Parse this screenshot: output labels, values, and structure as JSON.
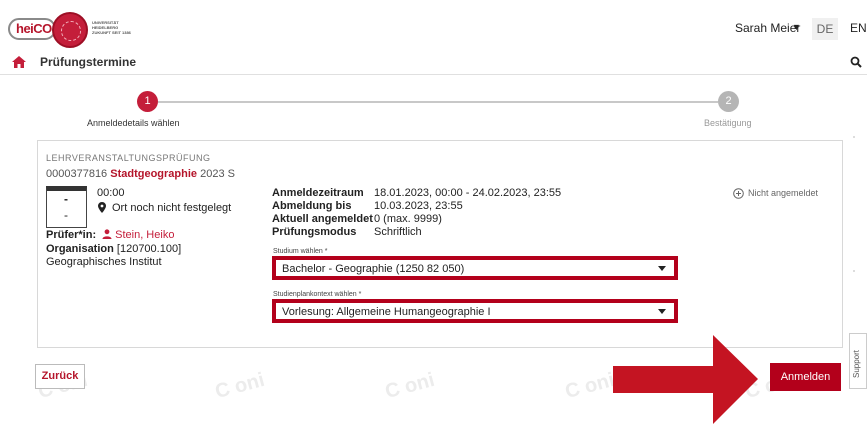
{
  "header": {
    "logo": "heiCO",
    "university_logo_text": "UNIVERSITÄT HEIDELBERG ZUKUNFT SEIT 1386",
    "user_name": "Sarah Meier",
    "lang_de": "DE",
    "lang_en": "EN"
  },
  "nav": {
    "page_title": "Prüfungstermine"
  },
  "stepper": {
    "steps": [
      {
        "num": "1",
        "label": "Anmeldedetails wählen"
      },
      {
        "num": "2",
        "label": "Bestätigung"
      }
    ]
  },
  "exam": {
    "kicker": "LEHRVERANSTALTUNGSPRÜFUNG",
    "course_number": "0000377816",
    "course_title": "Stadtgeographie",
    "semester": "2023 S",
    "date_day": "-",
    "date_month": "-",
    "time": "00:00",
    "location": "Ort noch nicht festgelegt",
    "examiner_label": "Prüfer*in:",
    "examiner": "Stein, Heiko",
    "org_label": "Organisation",
    "org_value": "[120700.100] Geographisches Institut",
    "details": [
      {
        "label": "Anmeldezeitraum",
        "value": "18.01.2023, 00:00 - 24.02.2023, 23:55"
      },
      {
        "label": "Abmeldung bis",
        "value": "10.03.2023, 23:55"
      },
      {
        "label": "Aktuell angemeldet",
        "value": "0 (max. 9999)"
      },
      {
        "label": "Prüfungsmodus",
        "value": "Schriftlich"
      }
    ],
    "status": "Nicht angemeldet"
  },
  "form": {
    "studium_label": "Studium wählen *",
    "studium_value": "Bachelor - Geographie (1250 82 050)",
    "kontext_label": "Studienplankontext wählen *",
    "kontext_value": "Vorlesung: Allgemeine Humangeographie I"
  },
  "actions": {
    "back": "Zurück",
    "submit": "Anmelden"
  },
  "support": "Support",
  "watermark": "CAMPUSonline SYSTEM",
  "colors": {
    "accent": "#c41e3a",
    "highlight": "#b3001b"
  }
}
